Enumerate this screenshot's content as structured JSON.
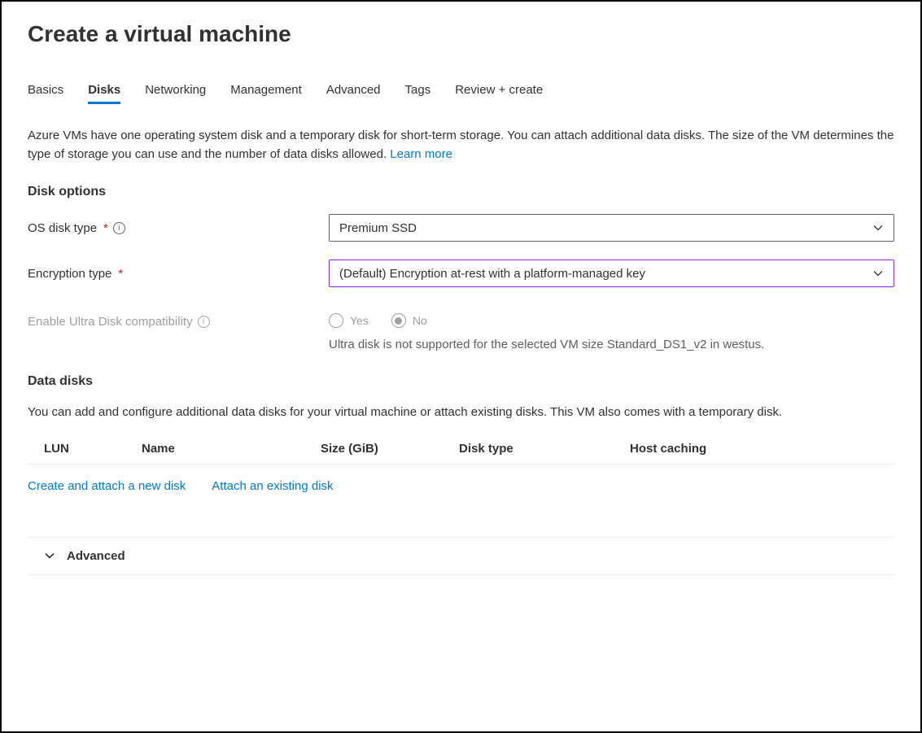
{
  "title": "Create a virtual machine",
  "tabs": [
    {
      "label": "Basics",
      "active": false
    },
    {
      "label": "Disks",
      "active": true
    },
    {
      "label": "Networking",
      "active": false
    },
    {
      "label": "Management",
      "active": false
    },
    {
      "label": "Advanced",
      "active": false
    },
    {
      "label": "Tags",
      "active": false
    },
    {
      "label": "Review + create",
      "active": false
    }
  ],
  "intro": {
    "text": "Azure VMs have one operating system disk and a temporary disk for short-term storage. You can attach additional data disks. The size of the VM determines the type of storage you can use and the number of data disks allowed.  ",
    "learn_more": "Learn more"
  },
  "disk_options": {
    "heading": "Disk options",
    "os_disk_type": {
      "label": "OS disk type",
      "value": "Premium SSD"
    },
    "encryption_type": {
      "label": "Encryption type",
      "value": "(Default) Encryption at-rest with a platform-managed key"
    },
    "ultra": {
      "label": "Enable Ultra Disk compatibility",
      "yes": "Yes",
      "no": "No",
      "selected": "No",
      "helper": "Ultra disk is not supported for the selected VM size Standard_DS1_v2 in westus."
    }
  },
  "data_disks": {
    "heading": "Data disks",
    "description": "You can add and configure additional data disks for your virtual machine or attach existing disks. This VM also comes with a temporary disk.",
    "columns": {
      "lun": "LUN",
      "name": "Name",
      "size": "Size (GiB)",
      "type": "Disk type",
      "cache": "Host caching"
    },
    "actions": {
      "create": "Create and attach a new disk",
      "attach": "Attach an existing disk"
    }
  },
  "advanced": {
    "label": "Advanced"
  }
}
